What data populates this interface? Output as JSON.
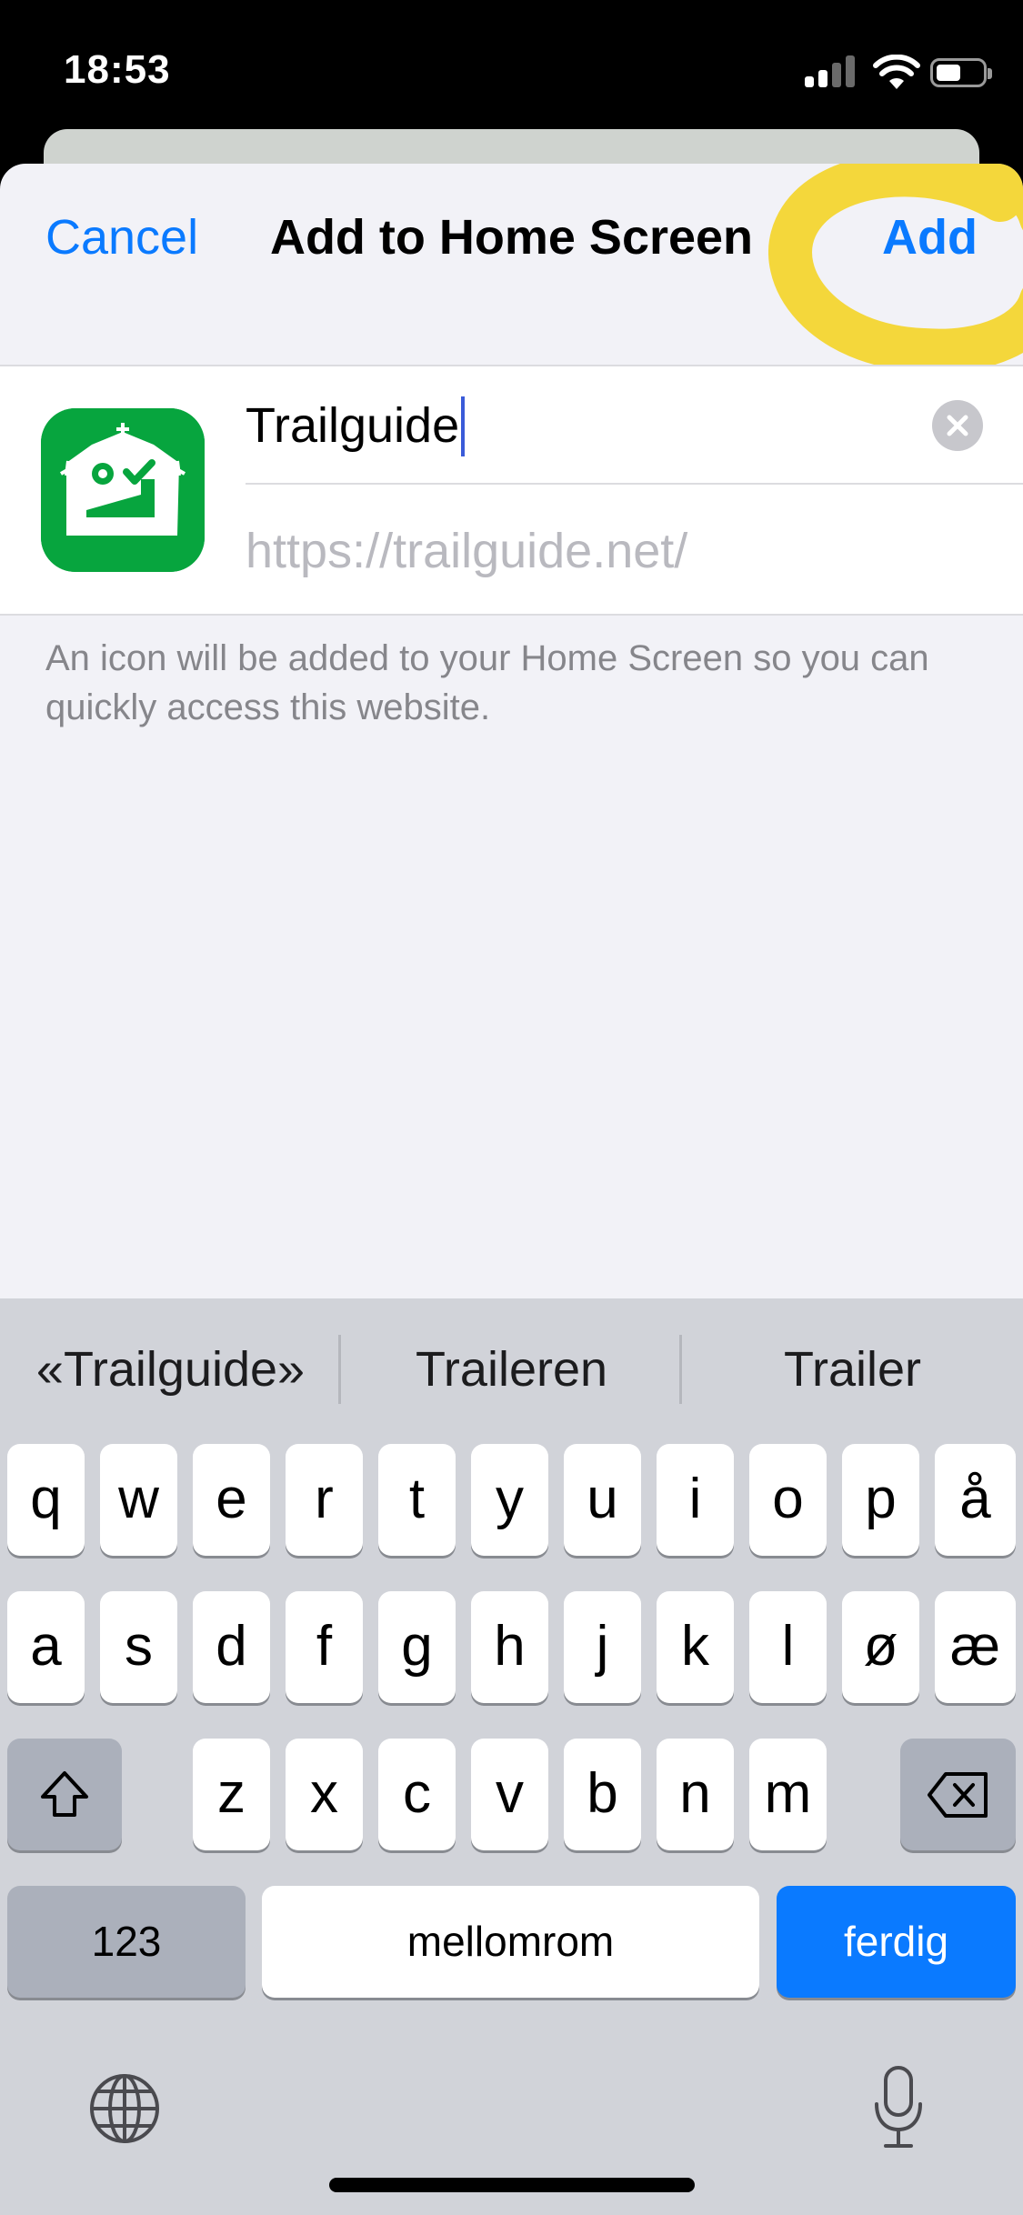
{
  "status_bar": {
    "time": "18:53"
  },
  "sheet": {
    "cancel_label": "Cancel",
    "title": "Add to Home Screen",
    "add_label": "Add",
    "name_value": "Trailguide",
    "url_value": "https://trailguide.net/",
    "caption": "An icon will be added to your Home Screen so you can quickly access this website."
  },
  "keyboard": {
    "suggestions": [
      "«Trailguide»",
      "Traileren",
      "Trailer"
    ],
    "row1": [
      "q",
      "w",
      "e",
      "r",
      "t",
      "y",
      "u",
      "i",
      "o",
      "p",
      "å"
    ],
    "row2": [
      "a",
      "s",
      "d",
      "f",
      "g",
      "h",
      "j",
      "k",
      "l",
      "ø",
      "æ"
    ],
    "row3": [
      "z",
      "x",
      "c",
      "v",
      "b",
      "n",
      "m"
    ],
    "numbers_label": "123",
    "space_label": "mellomrom",
    "done_label": "ferdig",
    "icons": [
      "shift-icon",
      "backspace-icon",
      "globe-icon",
      "microphone-icon"
    ]
  },
  "colors": {
    "accent": "#0a7aff",
    "app_icon_green": "#07a53e",
    "highlight": "#f5d21a"
  }
}
